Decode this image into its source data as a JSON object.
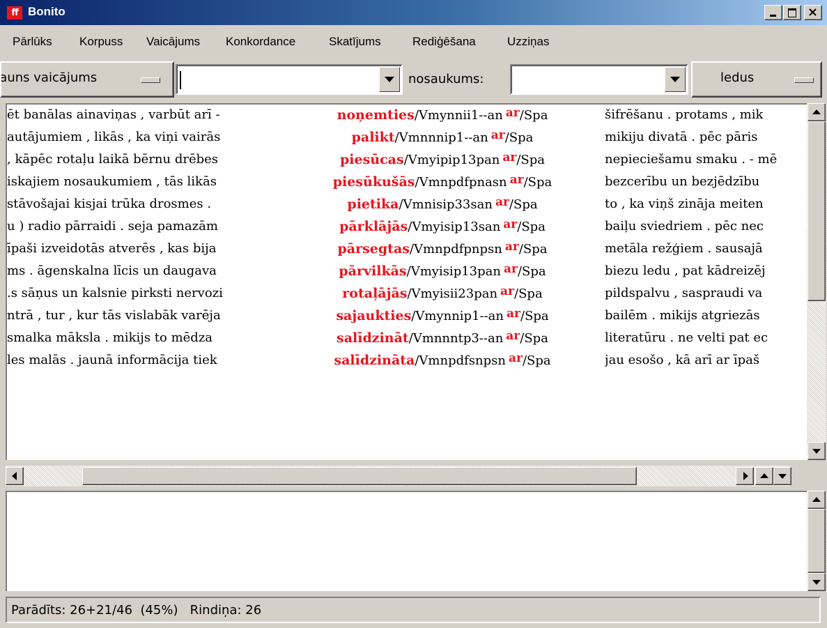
{
  "window": {
    "title": "Bonito",
    "icon_text": "ff",
    "controls": [
      "minimize",
      "maximize",
      "close"
    ]
  },
  "menu": [
    "Pārlūks",
    "Korpuss",
    "Vaicājums",
    "Konkordance",
    "Skatījums",
    "Rediģēšana",
    "Uzziņas"
  ],
  "toolbar": {
    "query_button_label": "Jauns vaicājums",
    "query_value": "",
    "name_label": "nosaukums:",
    "name_value": "",
    "right_button_label": "ledus"
  },
  "concordance": {
    "colors": {
      "keyword": "#e8141c"
    },
    "rows": [
      {
        "left": "ēt banālas ainaviņas , varbūt arī -",
        "kw": "noņemties",
        "tag": "/Vmynnii1--an",
        "prep": "ar",
        "prep_tag": "/Spa",
        "right": "šifrēšanu . protams , mik"
      },
      {
        "left": "autājumiem , likās , ka viņi vairās",
        "kw": "palikt",
        "tag": "/Vmnnnip1--an",
        "prep": "ar",
        "prep_tag": "/Spa",
        "right": "mikiju divatā . pēc pāris"
      },
      {
        "left": ", kāpēc rotaļu laikā bērnu drēbes",
        "kw": "piesūcas",
        "tag": "/Vmyipip13pan",
        "prep": "ar",
        "prep_tag": "/Spa",
        "right": "nepieciešamu smaku . - mē"
      },
      {
        "left": "iskajiem nosaukumiem , tās likās",
        "kw": "piesūkušās",
        "tag": "/Vmnpdfpnasn",
        "prep": "ar",
        "prep_tag": "/Spa",
        "right": "bezcerību un bezjēdzību"
      },
      {
        "left": "stāvošajai kisjai trūka drosmes .",
        "kw": "pietika",
        "tag": "/Vmnisip33san",
        "prep": "ar",
        "prep_tag": "/Spa",
        "right": "to , ka viņš zināja meiten"
      },
      {
        "left": "u ) radio pārraidi . seja pamazām",
        "kw": "pārklājās",
        "tag": "/Vmyisip13san",
        "prep": "ar",
        "prep_tag": "/Spa",
        "right": "baiļu sviedriem . pēc nec"
      },
      {
        "left": "īpaši izveidotās atverēs , kas bija",
        "kw": "pārsegtas",
        "tag": "/Vmnpdfpnpsn",
        "prep": "ar",
        "prep_tag": "/Spa",
        "right": "metāla režģiem . sausajā"
      },
      {
        "left": "ms . āgenskalna līcis un daugava",
        "kw": "pārvilkās",
        "tag": "/Vmyisip13pan",
        "prep": "ar",
        "prep_tag": "/Spa",
        "right": "biezu ledu , pat kādreizēj"
      },
      {
        "left": ".s sāņus un kalsnie pirksti nervozi",
        "kw": "rotaļājās",
        "tag": "/Vmyisii23pan",
        "prep": "ar",
        "prep_tag": "/Spa",
        "right": "pildspalvu , saspraudi va"
      },
      {
        "left": "ntrā , tur , kur tās vislabāk varēja",
        "kw": "sajaukties",
        "tag": "/Vmynnip1--an",
        "prep": "ar",
        "prep_tag": "/Spa",
        "right": "bailēm . mikijs atgriezās"
      },
      {
        "left": "smalka māksla . mikijs to mēdza",
        "kw": "salīdzināt",
        "tag": "/Vmnnntp3--an",
        "prep": "ar",
        "prep_tag": "/Spa",
        "right": "literatūru . ne velti pat ec"
      },
      {
        "left": "les malās . jaunā informācija tiek",
        "kw": "salīdzināta",
        "tag": "/Vmnpdfsnpsn",
        "prep": "ar",
        "prep_tag": "/Spa",
        "right": "jau esošo , kā arī ar īpaš"
      }
    ]
  },
  "status": {
    "text": "Parādīts: 26+21/46  (45%)   Rindiņa: 26"
  }
}
